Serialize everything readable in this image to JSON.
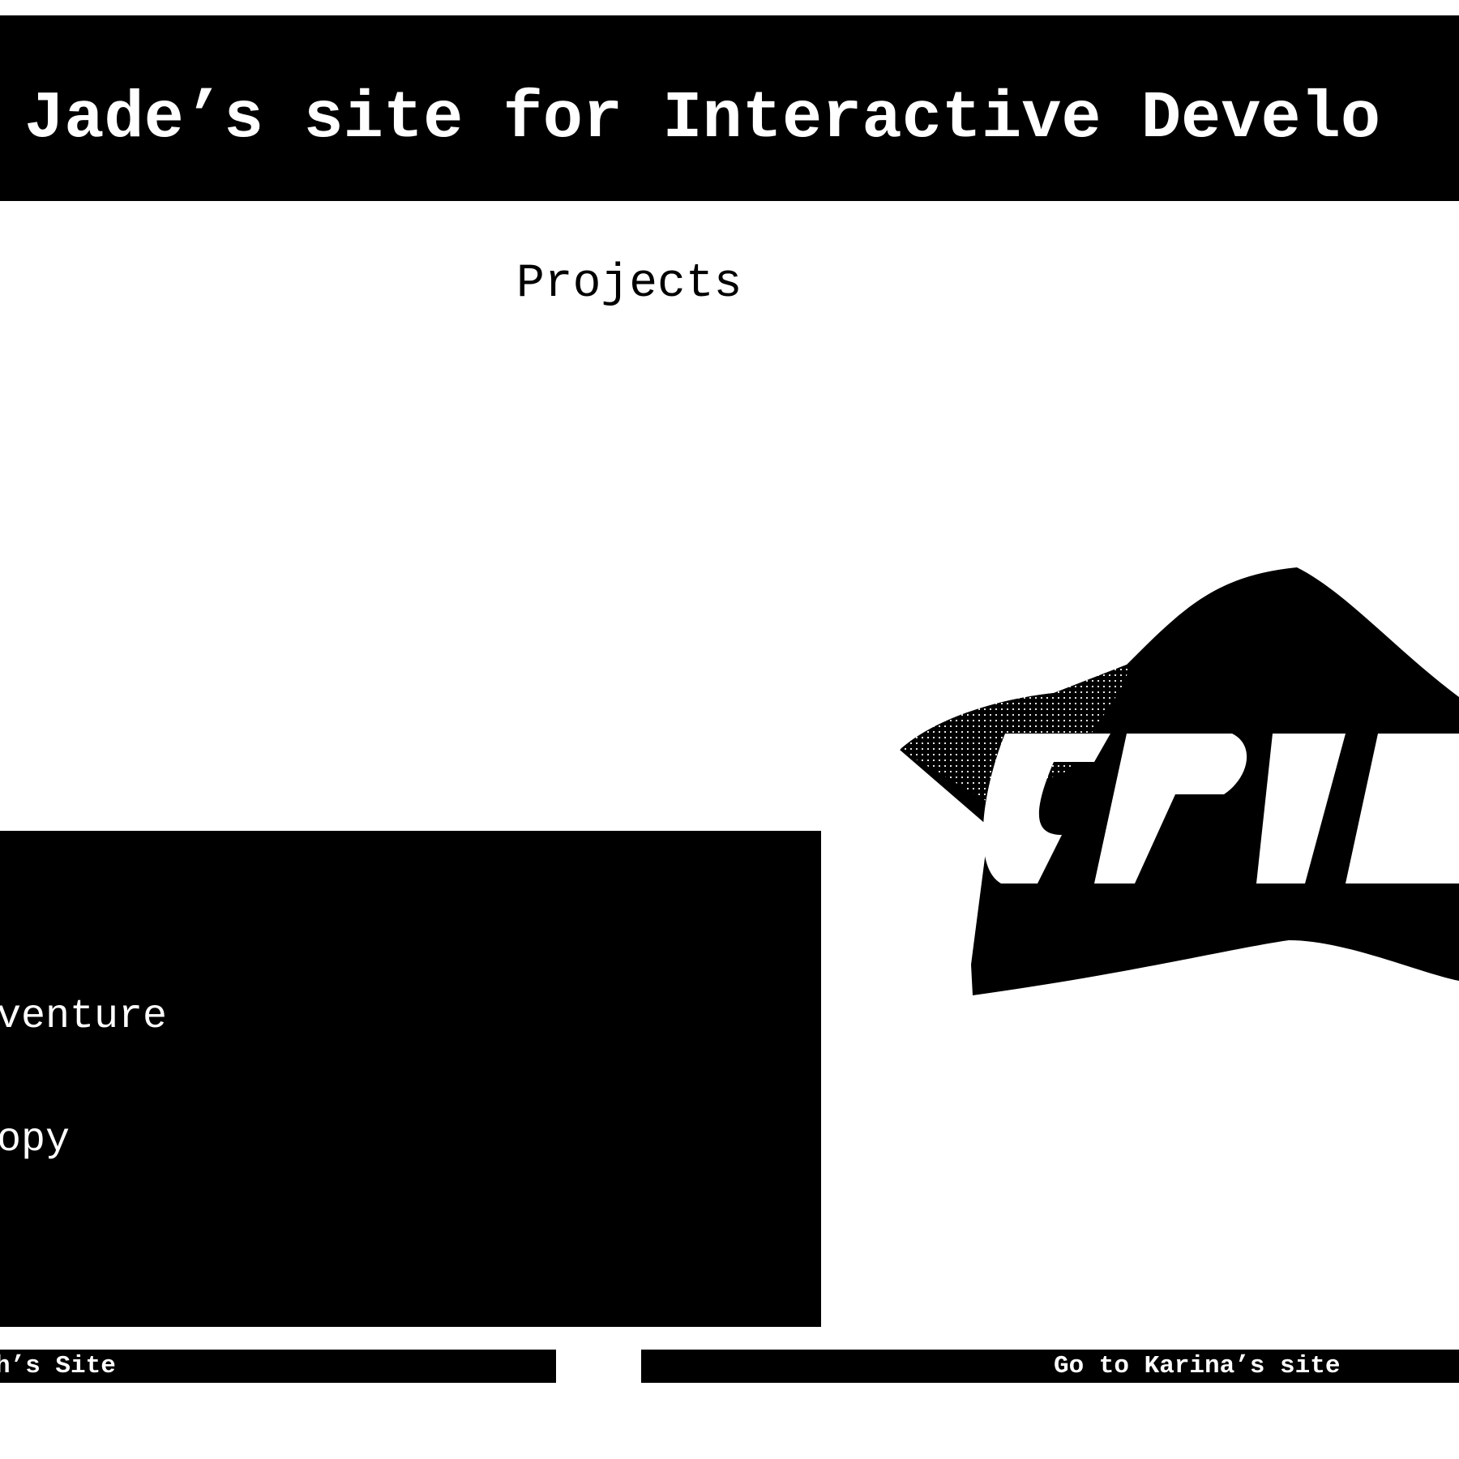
{
  "header": {
    "title": "Jade’s site for Interactive Develo"
  },
  "main": {
    "heading": "Projects",
    "project_list": [
      {
        "label": "venture"
      },
      {
        "label": "opy"
      }
    ]
  },
  "footer": {
    "prev_site_label": "h’s Site",
    "next_site_label": "Go to Karina’s site"
  }
}
